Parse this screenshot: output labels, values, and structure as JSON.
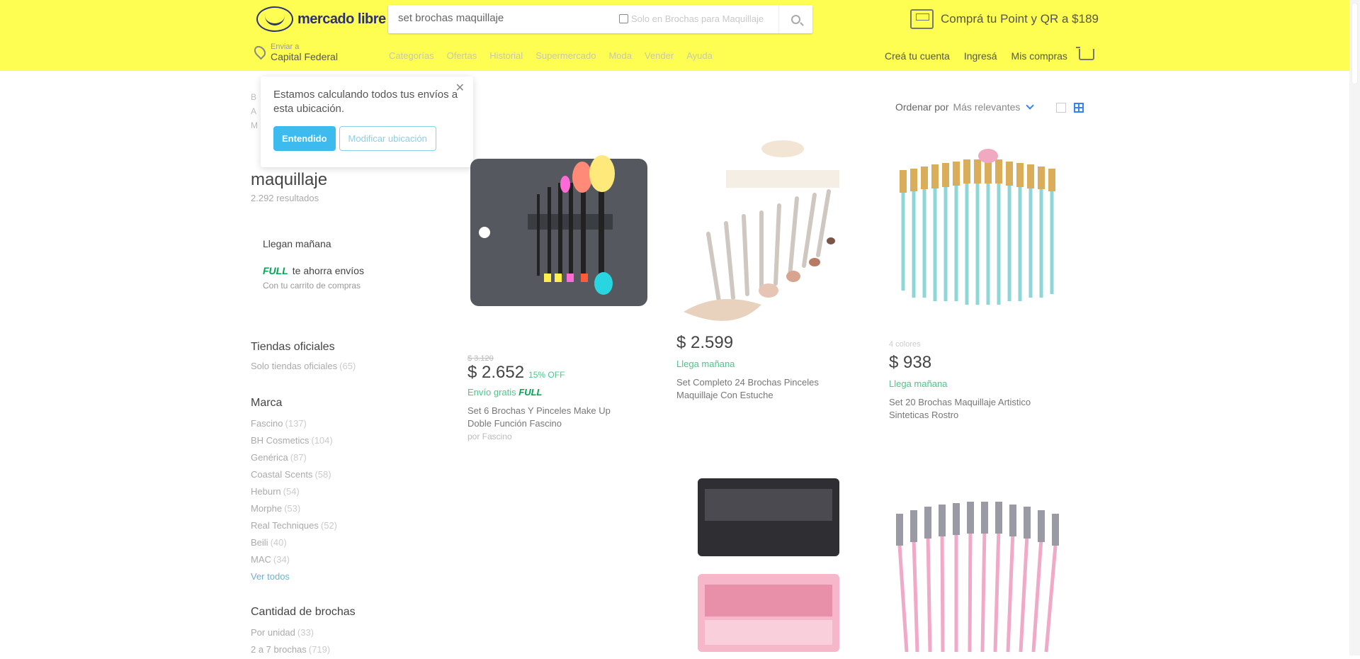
{
  "header": {
    "logo_text": "mercado libre",
    "search_value": "set brochas maquillaje",
    "search_scope": "Solo en Brochas para Maquillaje",
    "promo_text": "Comprá tu Point y QR a $189",
    "location_small": "Enviar a",
    "location_big": "Capital Federal",
    "nav": [
      "Categorías",
      "Ofertas",
      "Historial",
      "Supermercado",
      "Moda",
      "Vender",
      "Ayuda"
    ],
    "account": [
      "Creá tu cuenta",
      "Ingresá",
      "Mis compras"
    ]
  },
  "popup": {
    "message": "Estamos calculando todos tus envíos a esta ubicación.",
    "primary": "Entendido",
    "secondary": "Modificar ubicación"
  },
  "sidebar": {
    "title": "maquillaje",
    "results": "2.292 resultados",
    "ship_tomorrow": "Llegan mañana",
    "full_badge": "FULL",
    "full_text": "te ahorra envíos",
    "full_sub": "Con tu carrito de compras",
    "official": {
      "title": "Tiendas oficiales",
      "item": "Solo tiendas oficiales",
      "count": "(65)"
    },
    "brand": {
      "title": "Marca",
      "items": [
        {
          "label": "Fascino",
          "count": "(137)"
        },
        {
          "label": "BH Cosmetics",
          "count": "(104)"
        },
        {
          "label": "Genérica",
          "count": "(87)"
        },
        {
          "label": "Coastal Scents",
          "count": "(58)"
        },
        {
          "label": "Heburn",
          "count": "(54)"
        },
        {
          "label": "Morphe",
          "count": "(53)"
        },
        {
          "label": "Real Techniques",
          "count": "(52)"
        },
        {
          "label": "Beili",
          "count": "(40)"
        },
        {
          "label": "MAC",
          "count": "(34)"
        }
      ],
      "see_all": "Ver todos"
    },
    "quantity": {
      "title": "Cantidad de brochas",
      "items": [
        {
          "label": "Por unidad",
          "count": "(33)"
        },
        {
          "label": "2 a 7 brochas",
          "count": "(719)"
        }
      ]
    }
  },
  "sort": {
    "label": "Ordenar por",
    "value": "Más relevantes"
  },
  "products": [
    {
      "old_price": "$ 3.120",
      "price": "$ 2.652",
      "off": "15% OFF",
      "shipping": "Envío gratis",
      "full": "FULL",
      "name": "Set 6 Brochas Y Pinceles Make Up Doble Función Fascino",
      "seller": "por Fascino"
    },
    {
      "price": "$ 2.599",
      "delivery": "Llega mañana",
      "name": "Set Completo 24 Brochas Pinceles Maquillaje Con Estuche"
    },
    {
      "colors": "4 colores",
      "price": "$ 938",
      "delivery": "Llega mañana",
      "name": "Set 20 Brochas Maquillaje Artistico Sinteticas Rostro"
    }
  ]
}
